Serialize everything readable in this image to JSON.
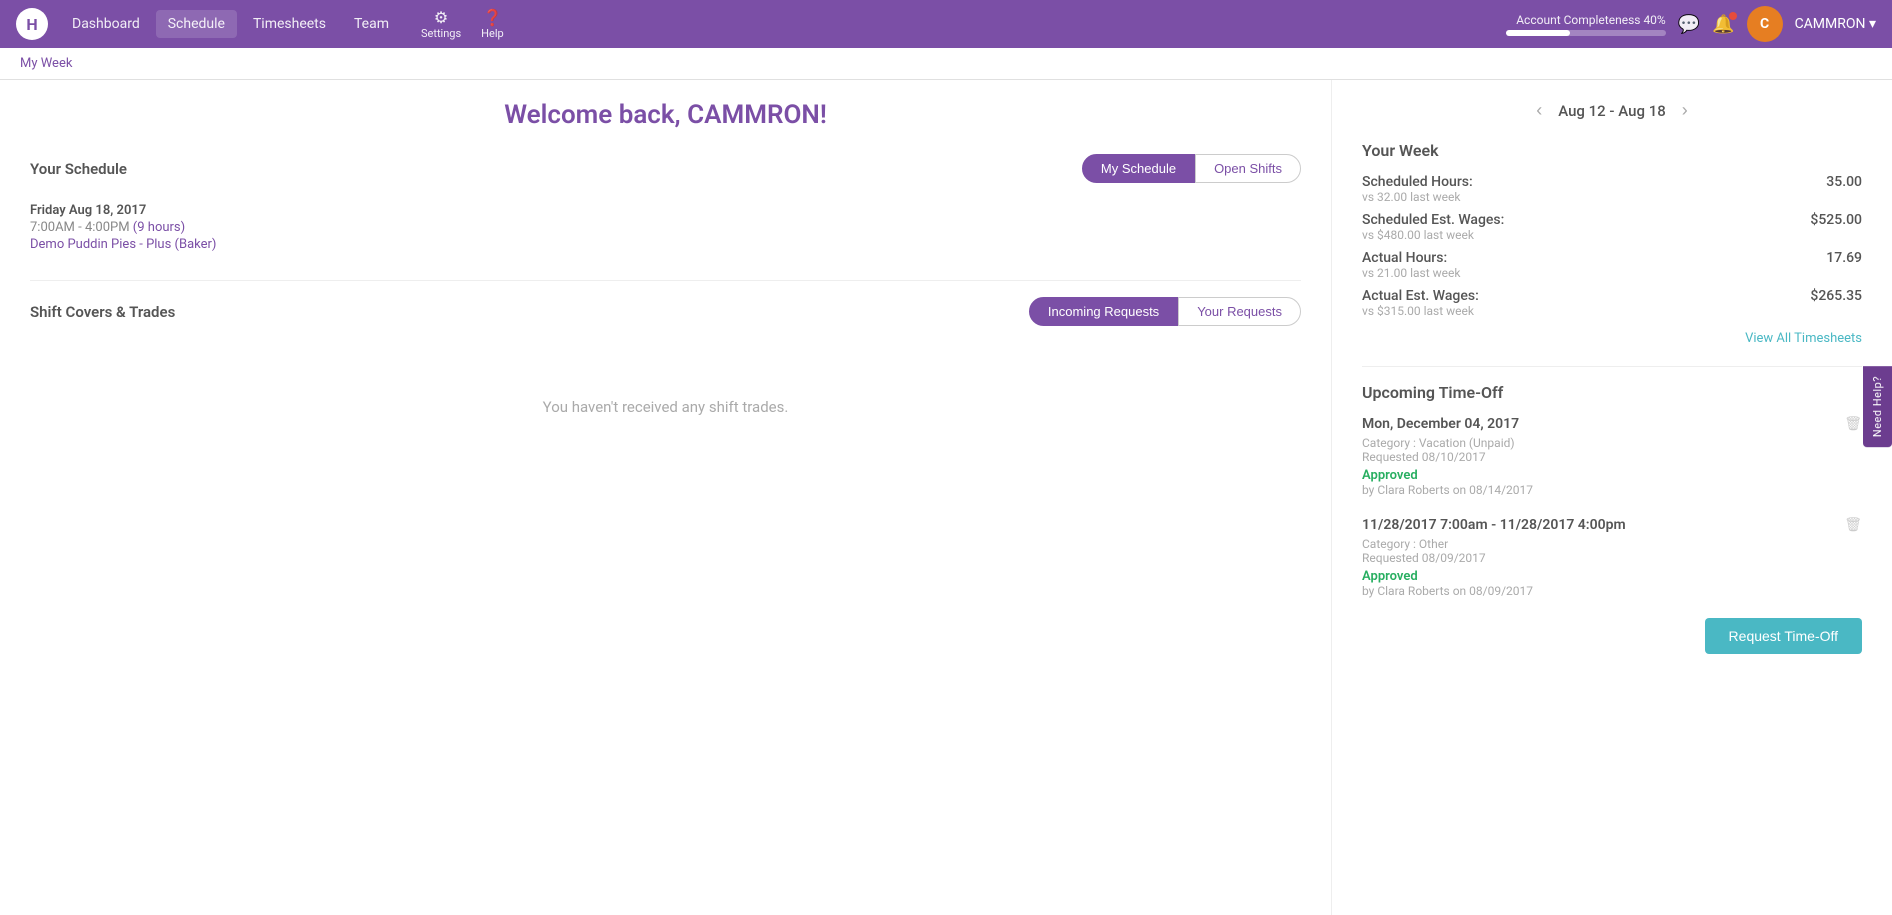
{
  "nav": {
    "logo_text": "H",
    "links": [
      {
        "label": "Dashboard",
        "active": false
      },
      {
        "label": "Schedule",
        "active": true
      },
      {
        "label": "Timesheets",
        "active": false
      },
      {
        "label": "Team",
        "active": false
      }
    ],
    "settings_label": "Settings",
    "help_label": "Help",
    "account_completeness_label": "Account Completeness 40%",
    "completeness_percent": 40,
    "user_name": "CAMMRON",
    "user_initial": "C"
  },
  "breadcrumb": "My Week",
  "main": {
    "welcome_title": "Welcome back, CAMMRON!"
  },
  "schedule": {
    "section_title": "Your Schedule",
    "tab_my_schedule": "My Schedule",
    "tab_open_shifts": "Open Shifts",
    "shift_date": "Friday Aug 18, 2017",
    "shift_time": "7:00AM - 4:00PM",
    "shift_hours": "(9 hours)",
    "shift_location": "Demo Puddin Pies - Plus (Baker)"
  },
  "shift_covers": {
    "section_title": "Shift Covers & Trades",
    "tab_incoming": "Incoming Requests",
    "tab_your_requests": "Your Requests",
    "empty_message": "You haven't received any shift trades."
  },
  "week": {
    "label": "Aug 12 - Aug 18",
    "section_title": "Your Week",
    "stats": [
      {
        "label": "Scheduled Hours:",
        "sublabel": "vs 32.00 last week",
        "value": "35.00"
      },
      {
        "label": "Scheduled Est. Wages:",
        "sublabel": "vs $480.00 last week",
        "value": "$525.00"
      },
      {
        "label": "Actual Hours:",
        "sublabel": "vs 21.00 last week",
        "value": "17.69"
      },
      {
        "label": "Actual Est. Wages:",
        "sublabel": "vs $315.00 last week",
        "value": "$265.35"
      }
    ],
    "view_all_timesheets": "View All Timesheets"
  },
  "time_off": {
    "section_title": "Upcoming Time-Off",
    "items": [
      {
        "date": "Mon, December 04, 2017",
        "category": "Category : Vacation (Unpaid)",
        "requested": "Requested 08/10/2017",
        "status": "Approved",
        "approved_by": "by Clara Roberts on 08/14/2017"
      },
      {
        "date": "11/28/2017 7:00am - 11/28/2017 4:00pm",
        "category": "Category : Other",
        "requested": "Requested 08/09/2017",
        "status": "Approved",
        "approved_by": "by Clara Roberts on 08/09/2017"
      }
    ],
    "request_button": "Request Time-Off"
  },
  "need_help": "Need Help?"
}
